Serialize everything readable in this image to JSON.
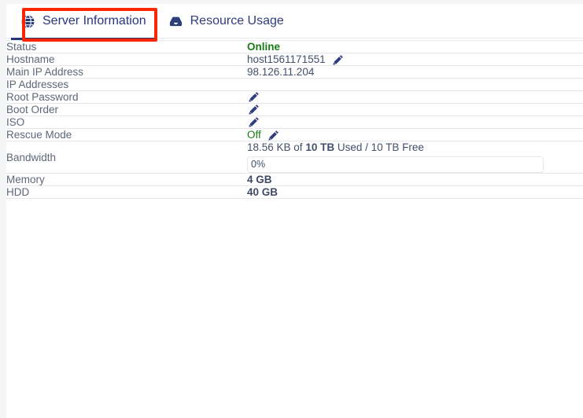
{
  "tabs": [
    {
      "id": "server-information",
      "label": "Server Information",
      "icon": "globe-icon",
      "active": true
    },
    {
      "id": "resource-usage",
      "label": "Resource Usage",
      "icon": "inbox-icon",
      "active": false
    }
  ],
  "colors": {
    "accent": "#243878",
    "tab_text": "#2e3d7c",
    "status_online": "#1a7a17",
    "highlight_box": "#fa2600",
    "row_divider": "#e4e6ea",
    "label_text": "#5d6778",
    "value_text": "#41506b",
    "page_background": "#f4f5f7",
    "card_background": "#ffffff",
    "progress_fill": "#2f3f7f"
  },
  "rows": [
    {
      "label": "Status",
      "value": "Online",
      "style": "green-bold",
      "edit": false
    },
    {
      "label": "Hostname",
      "value": "host1561171551",
      "style": "plain",
      "edit": true
    },
    {
      "label": "Main IP Address",
      "value": "98.126.11.204",
      "style": "plain",
      "edit": false
    },
    {
      "label": "IP Addresses",
      "value": "",
      "style": "plain",
      "edit": false
    },
    {
      "label": "Root Password",
      "value": "",
      "style": "plain",
      "edit": true
    },
    {
      "label": "Boot Order",
      "value": "",
      "style": "plain",
      "edit": true
    },
    {
      "label": "ISO",
      "value": "",
      "style": "plain",
      "edit": true
    },
    {
      "label": "Rescue Mode",
      "value": "Off",
      "style": "green",
      "edit": true
    },
    {
      "label": "Memory",
      "value": "4 GB",
      "style": "bold",
      "edit": false
    },
    {
      "label": "HDD",
      "value": "40 GB",
      "style": "bold",
      "edit": false
    }
  ],
  "bandwidth": {
    "label": "Bandwidth",
    "used_text": "18.56 KB of ",
    "total_bold": "10 TB",
    "used_suffix": " Used / 10 TB Free",
    "percent_label": "0%",
    "percent_value": 0
  }
}
